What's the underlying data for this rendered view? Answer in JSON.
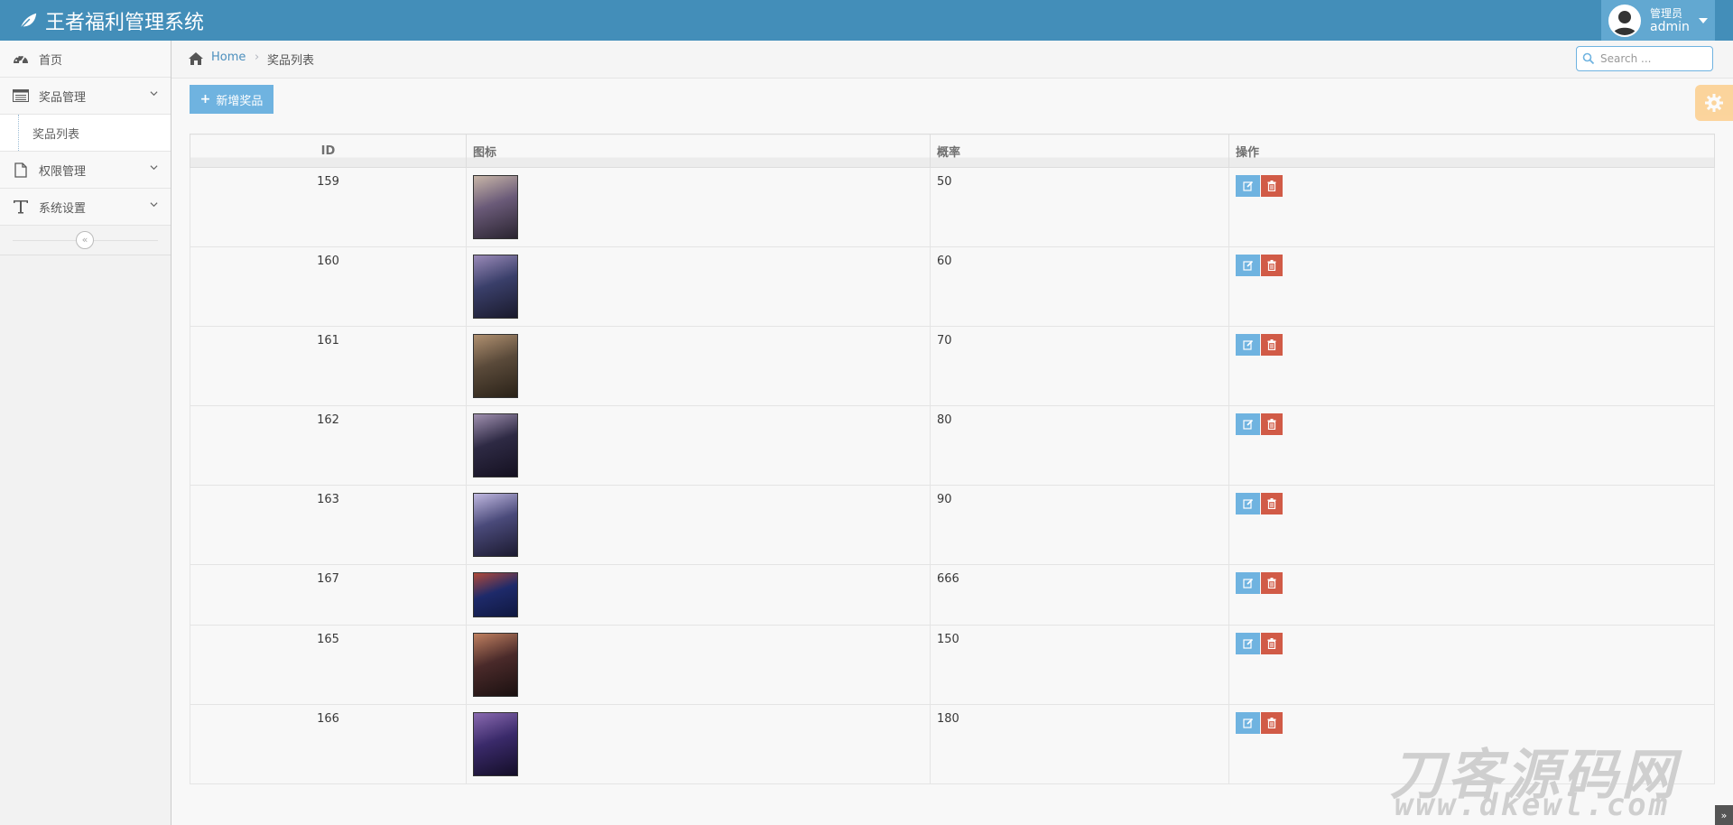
{
  "app": {
    "title": "王者福利管理系统"
  },
  "user": {
    "role": "管理员",
    "name": "admin"
  },
  "sidebar": {
    "items": [
      {
        "label": "首页",
        "icon": "dashboard-icon"
      },
      {
        "label": "奖品管理",
        "icon": "list-icon"
      },
      {
        "label": "奖品列表",
        "icon": ""
      },
      {
        "label": "权限管理",
        "icon": "file-icon"
      },
      {
        "label": "系统设置",
        "icon": "text-icon"
      }
    ],
    "collapse_label": "«"
  },
  "breadcrumb": {
    "home": "Home",
    "separator": "›",
    "current": "奖品列表"
  },
  "search": {
    "placeholder": "Search ..."
  },
  "toolbar": {
    "add_plus": "+",
    "add_label": "新增奖品"
  },
  "table": {
    "headers": [
      "ID",
      "图标",
      "概率",
      "操作"
    ],
    "rows": [
      {
        "id": "159",
        "rate": "50"
      },
      {
        "id": "160",
        "rate": "60"
      },
      {
        "id": "161",
        "rate": "70"
      },
      {
        "id": "162",
        "rate": "80"
      },
      {
        "id": "163",
        "rate": "90"
      },
      {
        "id": "167",
        "rate": "666"
      },
      {
        "id": "165",
        "rate": "150"
      },
      {
        "id": "166",
        "rate": "180"
      }
    ]
  },
  "watermark": {
    "line1": "刀客源码网",
    "line2": "www.dkewl.com"
  },
  "scroll_up": "»",
  "colors": {
    "navbar": "#438eb9",
    "edit": "#6fb3e0",
    "delete": "#d15b47",
    "settings": "#ffb752"
  }
}
